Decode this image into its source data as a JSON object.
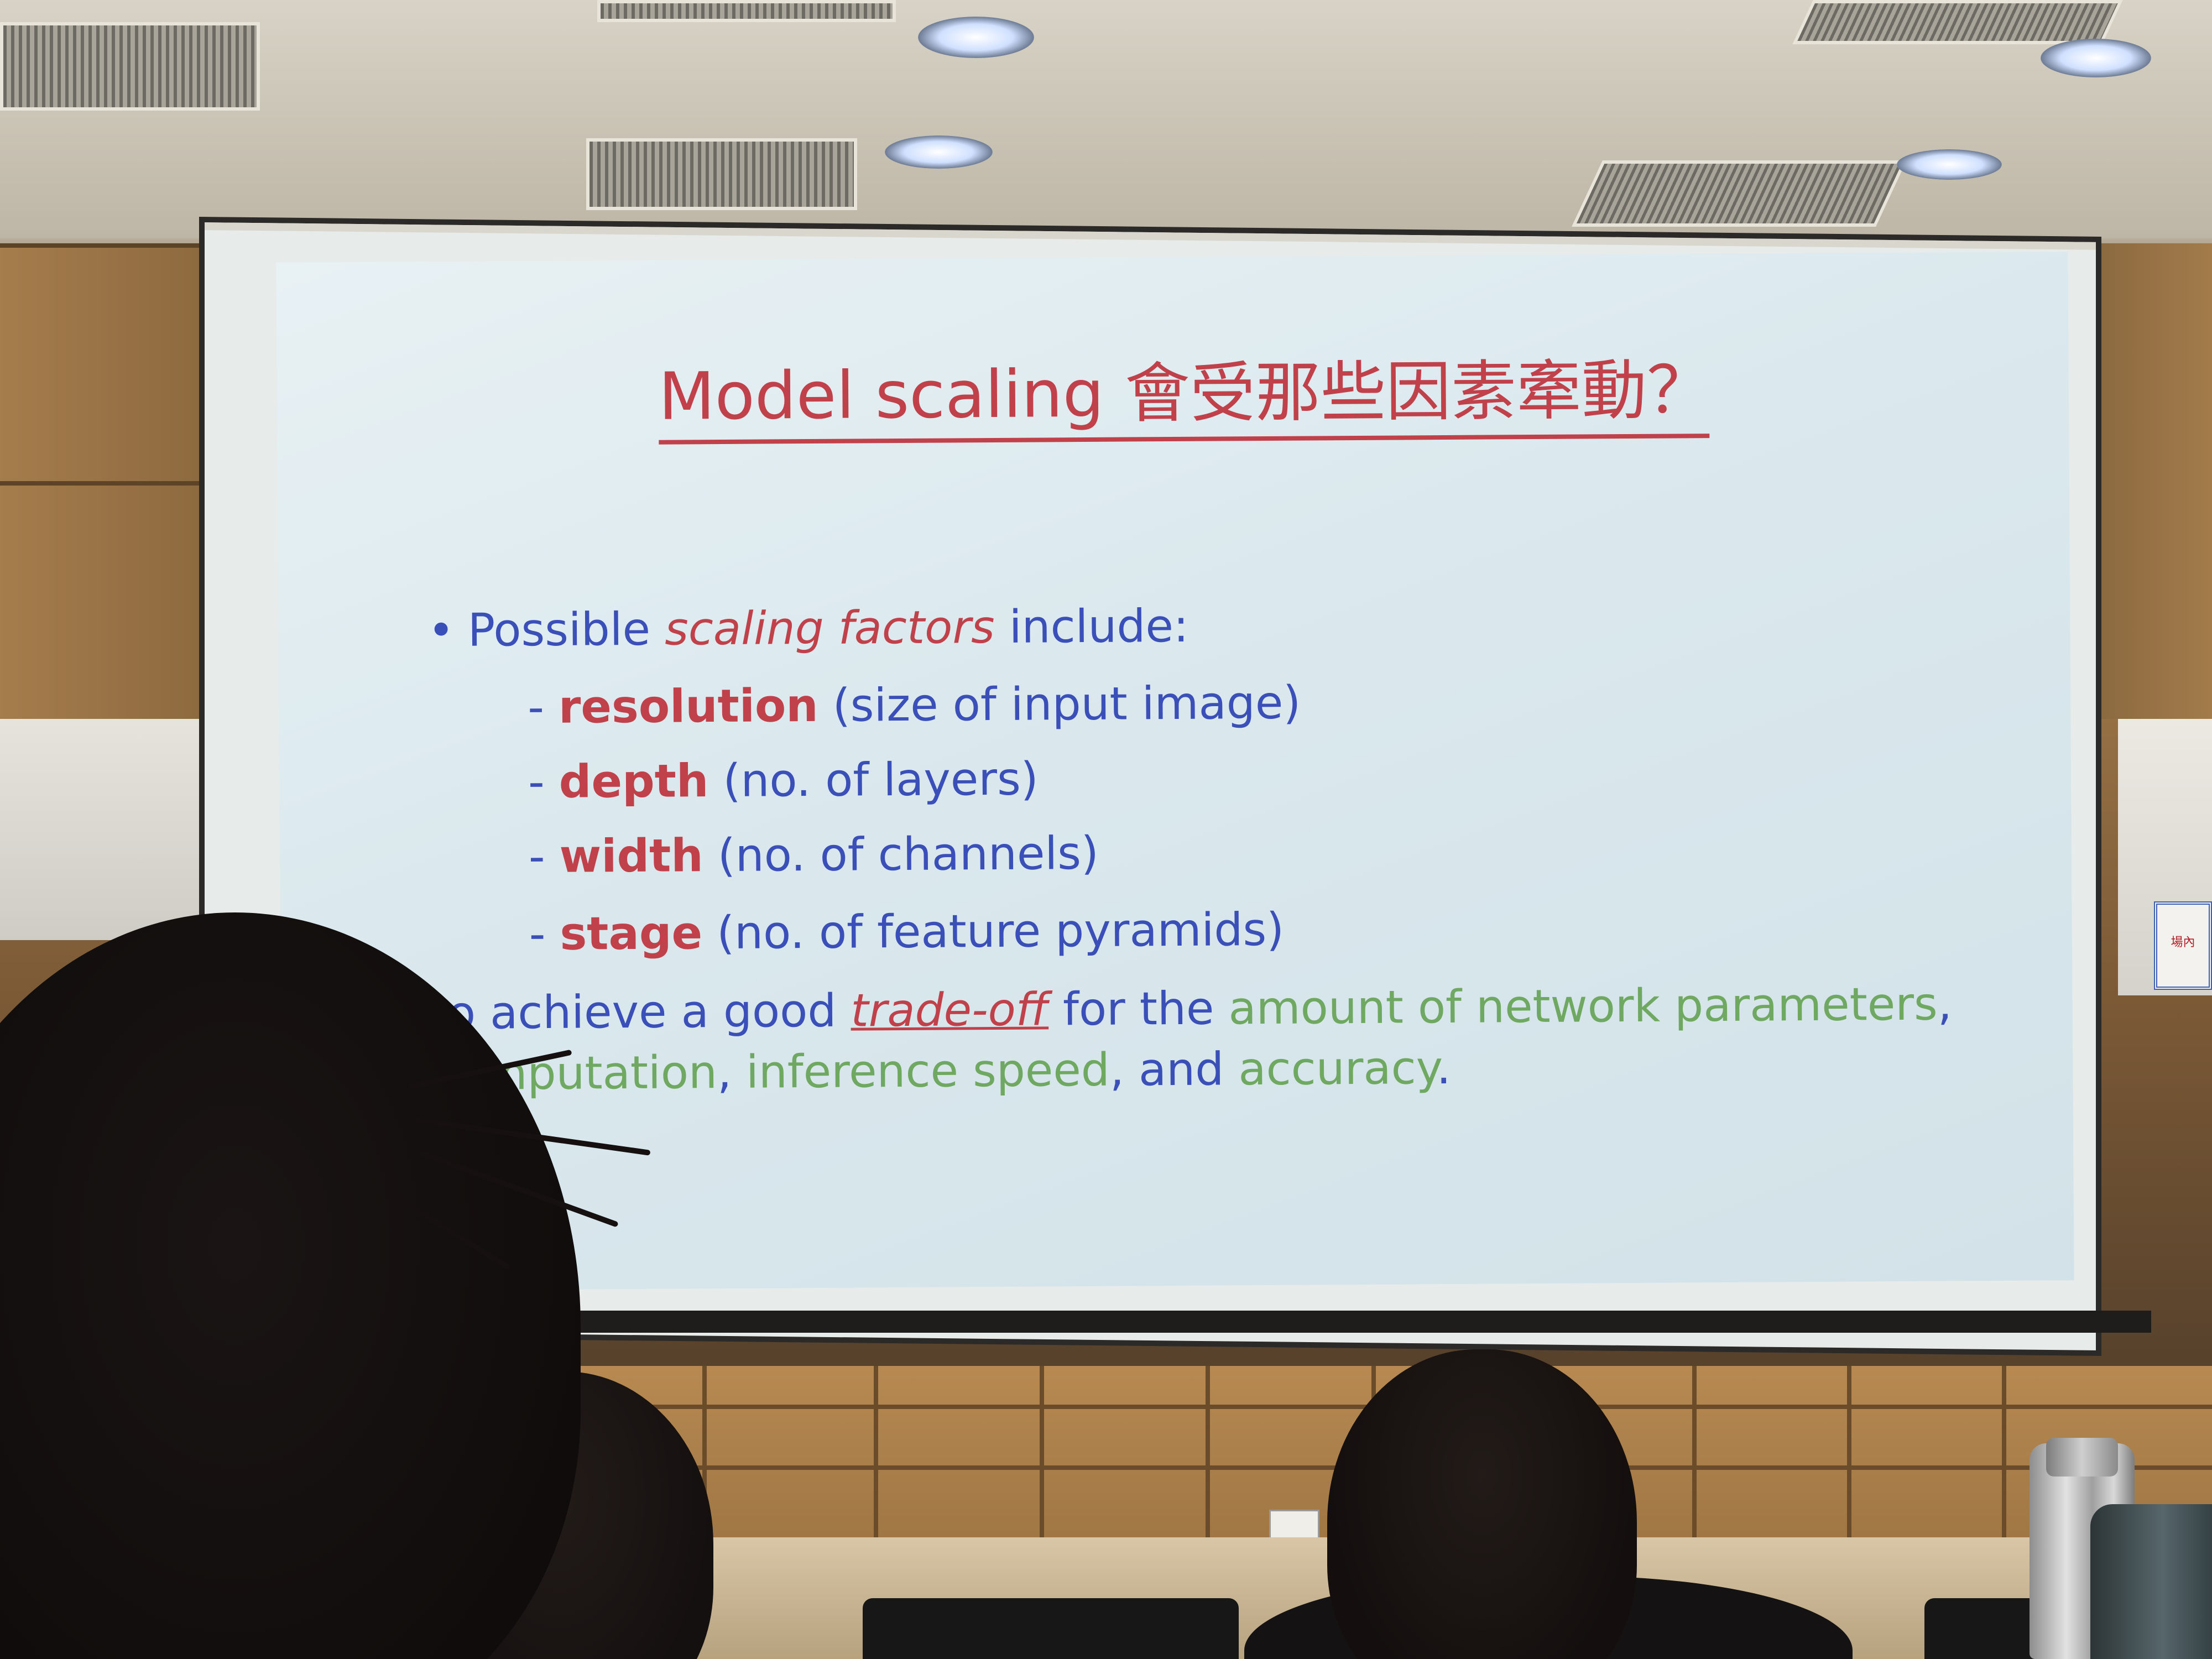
{
  "slide": {
    "title": "Model scaling 會受那些因素牽動？",
    "bullet": {
      "marker": "•",
      "prefix": "Possible ",
      "emphasis": "scaling factors",
      "suffix": " include:"
    },
    "factors": [
      {
        "dash": "- ",
        "key": "resolution",
        "detail": " (size of input image)"
      },
      {
        "dash": "- ",
        "key": "depth",
        "detail": " (no. of layers)"
      },
      {
        "dash": "- ",
        "key": "width",
        "detail": " (no. of channels)"
      },
      {
        "dash": "- ",
        "key": "stage",
        "detail": " (no. of feature pyramids)"
      }
    ],
    "summary": {
      "part1": "to achieve a good ",
      "tradeoff": "trade-off",
      "part2": " for the ",
      "green1": "amount of network parameters",
      "comma1": ", ",
      "green2": "computation",
      "comma2": ", ",
      "green3": "inference speed",
      "part3": ", and ",
      "green4": "accuracy",
      "end": "."
    },
    "colors": {
      "title": "#c0414a",
      "body": "#3a4fb8",
      "highlight_green": "#6fa860"
    }
  },
  "room": {
    "notice_text": "場內"
  }
}
